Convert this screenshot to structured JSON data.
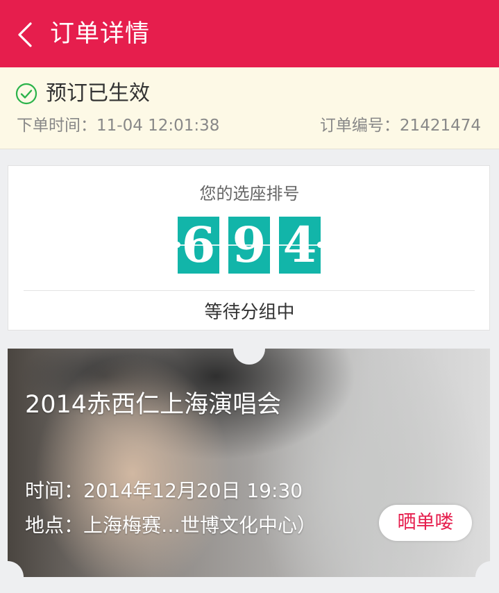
{
  "header": {
    "back_icon": "chevron-left-icon",
    "title": "订单详情",
    "bg_color": "#e61e4d"
  },
  "status": {
    "icon": "check-circle-icon",
    "text": "预订已生效",
    "order_time": "下单时间：11-04 12:01:38",
    "order_number": "订单编号：21421474"
  },
  "seat": {
    "title": "您的选座排号",
    "digits": [
      "6",
      "9",
      "4"
    ],
    "digit_color": "#12b5a9",
    "status_text": "等待分组中"
  },
  "event": {
    "title": "2014赤西仁上海演唱会",
    "time": "时间：2014年12月20日 19:30",
    "venue": "地点：上海梅赛…世博文化中心）",
    "share_button": "晒单喽"
  }
}
